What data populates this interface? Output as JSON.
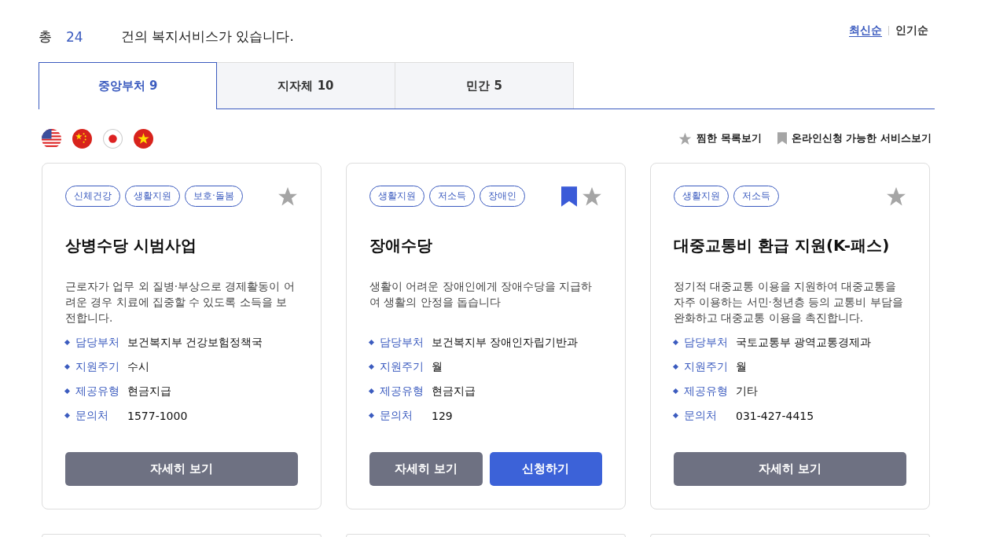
{
  "summary": {
    "prefix": "총",
    "count": "24",
    "suffix": "건의 복지서비스가 있습니다."
  },
  "sort": [
    {
      "label": "최신순",
      "selected": true
    },
    {
      "label": "인기순",
      "selected": false
    }
  ],
  "tabs": [
    {
      "label": "중앙부처 9",
      "selected": true
    },
    {
      "label": "지자체 10",
      "selected": false
    },
    {
      "label": "민간 5",
      "selected": false
    }
  ],
  "languages": [
    {
      "kind": "us"
    },
    {
      "kind": "cn"
    },
    {
      "kind": "jp"
    },
    {
      "kind": "vn"
    }
  ],
  "filters": [
    {
      "kind": "star",
      "label": "찜한 목록보기"
    },
    {
      "kind": "bookmark",
      "label": "온라인신청 가능한 서비스보기"
    }
  ],
  "cards": [
    {
      "tags": [
        "신체건강",
        "생활지원",
        "보호·돌봄"
      ],
      "online": false,
      "favorite": false,
      "title": "상병수당 시범사업",
      "description": "근로자가 업무 외 질병·부상으로 경제활동이 어려운 경우 치료에 집중할 수 있도록 소득을 보전합니다.",
      "info": [
        {
          "label": "담당부처",
          "value": "보건복지부 건강보험정책국"
        },
        {
          "label": "지원주기",
          "value": "수시"
        },
        {
          "label": "제공유형",
          "value": "현금지급"
        },
        {
          "label": "문의처",
          "value": "1577-1000"
        }
      ],
      "buttons": [
        {
          "kind": "detail",
          "label": "자세히 보기"
        }
      ]
    },
    {
      "tags": [
        "생활지원",
        "저소득",
        "장애인"
      ],
      "online": true,
      "favorite": false,
      "title": "장애수당",
      "description": "생활이 어려운 장애인에게 장애수당을 지급하여 생활의 안정을 돕습니다",
      "info": [
        {
          "label": "담당부처",
          "value": "보건복지부 장애인자립기반과"
        },
        {
          "label": "지원주기",
          "value": "월"
        },
        {
          "label": "제공유형",
          "value": "현금지급"
        },
        {
          "label": "문의처",
          "value": "129"
        }
      ],
      "buttons": [
        {
          "kind": "detail",
          "label": "자세히 보기"
        },
        {
          "kind": "apply",
          "label": "신청하기"
        }
      ]
    },
    {
      "tags": [
        "생활지원",
        "저소득"
      ],
      "online": false,
      "favorite": false,
      "title": "대중교통비 환급 지원(K-패스)",
      "description": "정기적 대중교통 이용을 지원하여 대중교통을 자주 이용하는 서민·청년층 등의 교통비 부담을 완화하고 대중교통 이용을 촉진합니다.",
      "info": [
        {
          "label": "담당부처",
          "value": "국토교통부 광역교통경제과"
        },
        {
          "label": "지원주기",
          "value": "월"
        },
        {
          "label": "제공유형",
          "value": "기타"
        },
        {
          "label": "문의처",
          "value": "031-427-4415"
        }
      ],
      "buttons": [
        {
          "kind": "detail",
          "label": "자세히 보기"
        }
      ]
    }
  ]
}
